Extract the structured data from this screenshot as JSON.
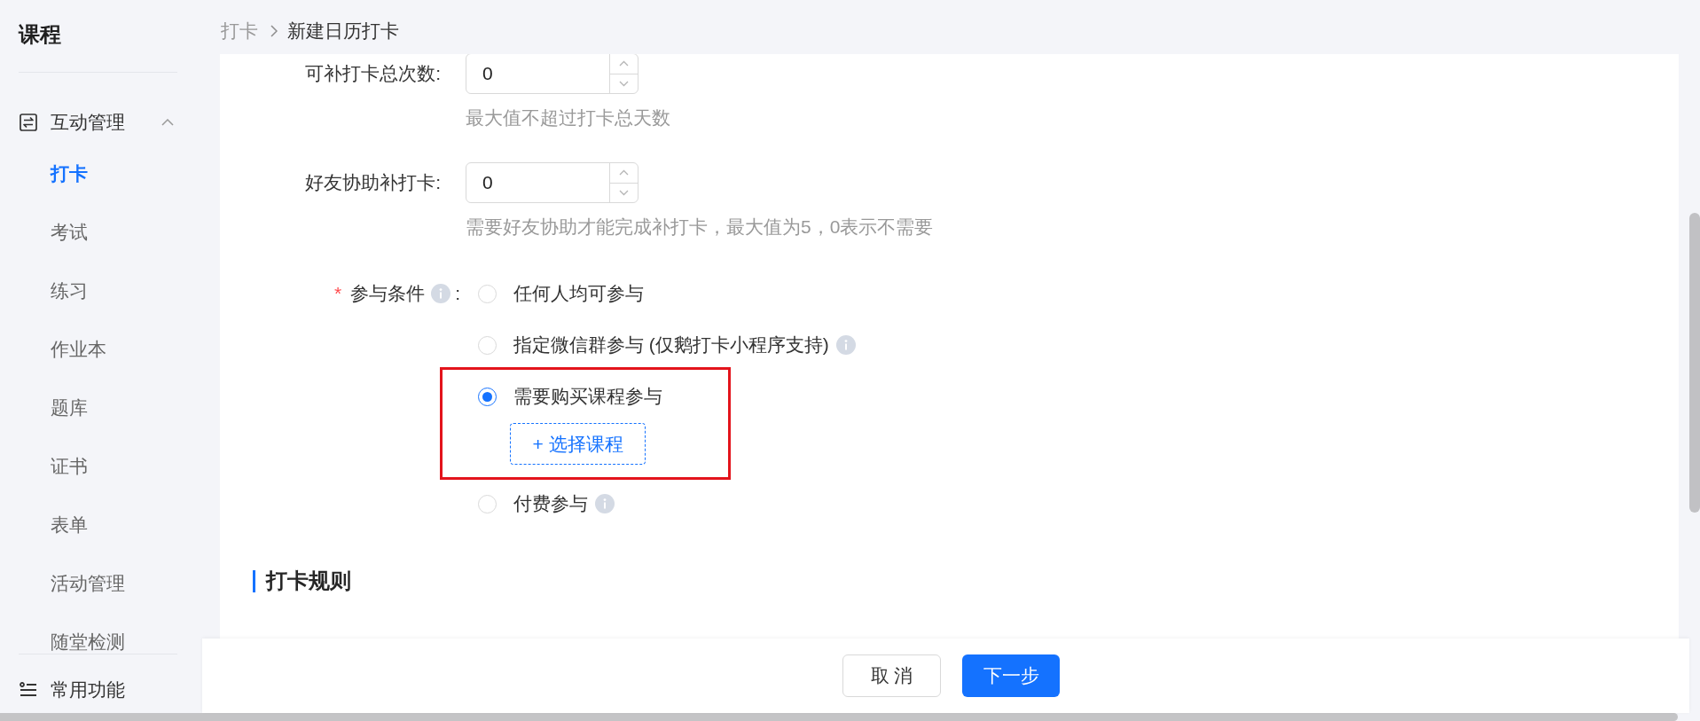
{
  "breadcrumb": [
    {
      "label": "打卡",
      "current": false
    },
    {
      "label": "新建日历打卡",
      "current": true
    }
  ],
  "sidebar": {
    "title": "课程",
    "group": {
      "label": "互动管理",
      "expanded": true,
      "items": [
        {
          "label": "打卡",
          "selected": true
        },
        {
          "label": "考试",
          "selected": false
        },
        {
          "label": "练习",
          "selected": false
        },
        {
          "label": "作业本",
          "selected": false
        },
        {
          "label": "题库",
          "selected": false
        },
        {
          "label": "证书",
          "selected": false
        },
        {
          "label": "表单",
          "selected": false
        },
        {
          "label": "活动管理",
          "selected": false
        },
        {
          "label": "随堂检测",
          "selected": false
        }
      ]
    },
    "bottom_item": {
      "label": "常用功能"
    }
  },
  "form": {
    "fields": [
      {
        "kind": "number",
        "label": "可补打卡总次数:",
        "value": "0",
        "hint": "最大值不超过打卡总天数"
      },
      {
        "kind": "number",
        "label": "好友协助补打卡:",
        "value": "0",
        "hint": "需要好友协助才能完成补打卡，最大值为5，0表示不需要"
      },
      {
        "kind": "radio",
        "required_mark": "*",
        "label": "参与条件",
        "info": true,
        "colon": ":",
        "options": [
          {
            "label": "任何人均可参与",
            "selected": false,
            "info": false,
            "highlighted": false
          },
          {
            "label": "指定微信群参与 (仅鹅打卡小程序支持)",
            "selected": false,
            "info": true,
            "highlighted": false
          },
          {
            "label": "需要购买课程参与",
            "selected": true,
            "info": false,
            "highlighted": true,
            "action": "+ 选择课程"
          },
          {
            "label": "付费参与",
            "selected": false,
            "info": true,
            "highlighted": false
          }
        ]
      }
    ]
  },
  "section": {
    "title": "打卡规则"
  },
  "footer": {
    "buttons": [
      {
        "label": "取 消",
        "kind": "default"
      },
      {
        "label": "下一步",
        "kind": "primary"
      }
    ]
  }
}
